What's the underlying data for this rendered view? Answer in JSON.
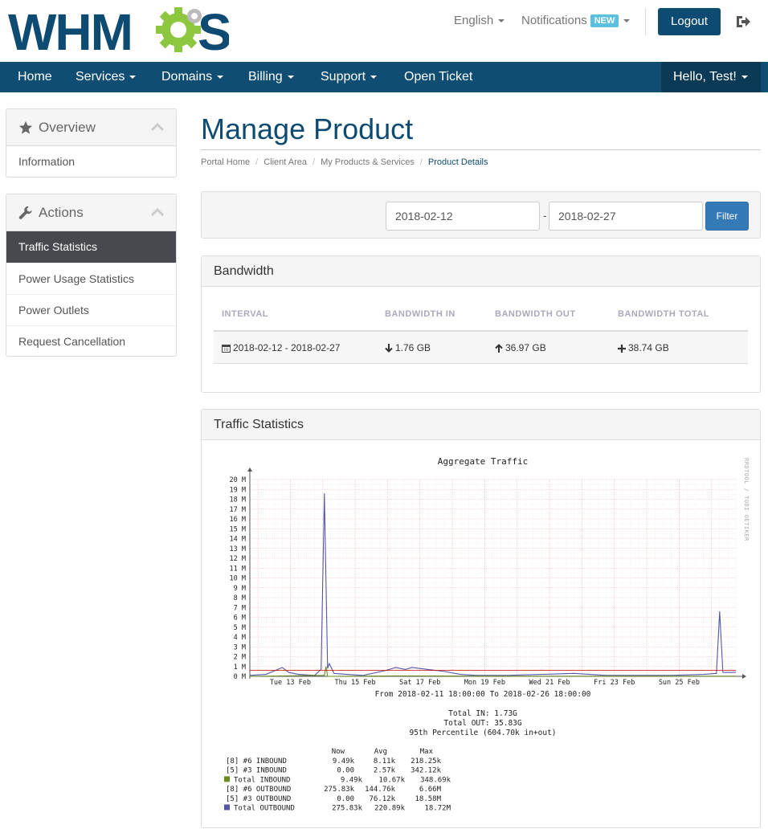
{
  "header": {
    "logo_text": "WHMCS",
    "language": "English",
    "notifications": "Notifications",
    "notifications_badge": "NEW",
    "logout": "Logout"
  },
  "nav": {
    "items": [
      "Home",
      "Services",
      "Domains",
      "Billing",
      "Support",
      "Open Ticket"
    ],
    "user": "Hello, Test!"
  },
  "sidebar": {
    "overview": {
      "title": "Overview",
      "items": [
        "Information"
      ]
    },
    "actions": {
      "title": "Actions",
      "items": [
        "Traffic Statistics",
        "Power Usage Statistics",
        "Power Outlets",
        "Request Cancellation"
      ],
      "active_index": 0
    }
  },
  "main": {
    "title": "Manage Product",
    "breadcrumb": [
      "Portal Home",
      "Client Area",
      "My Products & Services",
      "Product Details"
    ],
    "filter": {
      "date_from": "2018-02-12",
      "separator": "-",
      "date_to": "2018-02-27",
      "button": "Filter"
    },
    "bandwidth": {
      "title": "Bandwidth",
      "columns": [
        "INTERVAL",
        "BANDWIDTH IN",
        "BANDWIDTH OUT",
        "BANDWIDTH TOTAL"
      ],
      "row": {
        "interval": "2018-02-12 - 2018-02-27",
        "in": "1.76 GB",
        "out": "36.97 GB",
        "total": "38.74 GB"
      }
    },
    "traffic": {
      "title": "Traffic Statistics"
    }
  },
  "colors": {
    "primary": "#0e4b72",
    "nav": "#0f4d73",
    "filter_btn": "#337ab7",
    "in_series": "#6b8e23",
    "out_series": "#5555aa",
    "threshold": "#cc0000"
  },
  "chart_data": {
    "type": "line",
    "title": "Aggregate Traffic",
    "side_label": "RRDTOOL / TOBI OETIKER",
    "y_unit": "M",
    "ylim": [
      0,
      20
    ],
    "y_ticks": [
      0,
      1,
      2,
      3,
      4,
      5,
      6,
      7,
      8,
      9,
      10,
      11,
      12,
      13,
      14,
      15,
      16,
      17,
      18,
      19,
      20
    ],
    "x_tick_labels": [
      "Tue 13 Feb",
      "Thu 15 Feb",
      "Sat 17 Feb",
      "Mon 19 Feb",
      "Wed 21 Feb",
      "Fri 23 Feb",
      "Sun 25 Feb"
    ],
    "xlim_days": [
      "2018-02-11 18:00",
      "2018-02-26 18:00"
    ],
    "grid": true,
    "threshold": 0.6,
    "series": [
      {
        "name": "Total OUTBOUND",
        "points": [
          [
            0,
            0.1
          ],
          [
            0.5,
            0.2
          ],
          [
            1.0,
            0.9
          ],
          [
            1.2,
            0.4
          ],
          [
            1.5,
            0.2
          ],
          [
            2.0,
            0.1
          ],
          [
            2.2,
            0.7
          ],
          [
            2.3,
            18.6
          ],
          [
            2.4,
            0.8
          ],
          [
            2.45,
            1.3
          ],
          [
            2.6,
            0.3
          ],
          [
            3.0,
            0.2
          ],
          [
            3.5,
            0.1
          ],
          [
            4.2,
            0.6
          ],
          [
            4.5,
            0.9
          ],
          [
            4.8,
            0.7
          ],
          [
            5.0,
            0.9
          ],
          [
            5.5,
            0.7
          ],
          [
            6.0,
            0.5
          ],
          [
            6.5,
            0.2
          ],
          [
            7.0,
            0.1
          ],
          [
            8.0,
            0.1
          ],
          [
            9.0,
            0.2
          ],
          [
            10.0,
            0.3
          ],
          [
            11.0,
            0.1
          ],
          [
            12.0,
            0.1
          ],
          [
            13.0,
            0.1
          ],
          [
            14.0,
            0.2
          ],
          [
            14.4,
            0.3
          ],
          [
            14.5,
            6.6
          ],
          [
            14.6,
            0.4
          ],
          [
            15.0,
            0.4
          ]
        ]
      },
      {
        "name": "Total INBOUND",
        "points": [
          [
            0,
            0.0
          ],
          [
            2.3,
            0.1
          ],
          [
            2.35,
            1.0
          ],
          [
            2.4,
            0.0
          ],
          [
            4.5,
            0.05
          ],
          [
            8.0,
            0.02
          ],
          [
            15.0,
            0.02
          ]
        ]
      }
    ],
    "footer": {
      "range": "From 2018-02-11 18:00:00 To 2018-02-26 18:00:00",
      "total_in": "Total IN:   1.73G",
      "total_out": "Total OUT:  35.83G",
      "percentile": "95th Percentile (604.70k in+out)"
    },
    "legend_headers": [
      "Now",
      "Avg",
      "Max"
    ],
    "legend_rows": [
      {
        "label": "[8] #6 INBOUND",
        "now": "9.49k",
        "avg": "8.11k",
        "max": "218.25k",
        "swatch": ""
      },
      {
        "label": "[5] #3 INBOUND",
        "now": "0.00",
        "avg": "2.57k",
        "max": "342.12k",
        "swatch": ""
      },
      {
        "label": "Total INBOUND",
        "now": "9.49k",
        "avg": "10.67k",
        "max": "348.69k",
        "swatch": "#6b8e23"
      },
      {
        "label": "[8] #6 OUTBOUND",
        "now": "275.83k",
        "avg": "144.76k",
        "max": "6.66M",
        "swatch": ""
      },
      {
        "label": "[5] #3 OUTBOUND",
        "now": "0.00",
        "avg": "76.12k",
        "max": "18.58M",
        "swatch": ""
      },
      {
        "label": "Total OUTBOUND",
        "now": "275.83k",
        "avg": "220.89k",
        "max": "18.72M",
        "swatch": "#5555aa"
      }
    ]
  }
}
